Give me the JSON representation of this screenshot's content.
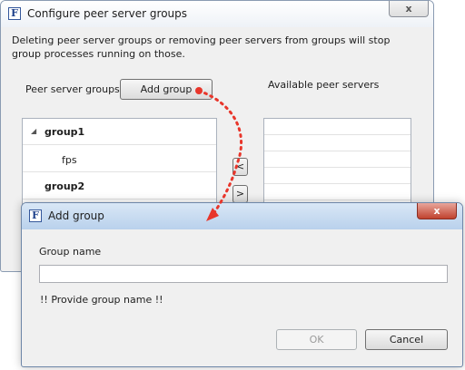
{
  "main_window": {
    "title": "Configure peer server groups",
    "icon_letter": "F",
    "close_label": "x",
    "info_text": "Deleting peer server groups or removing peer servers from groups will stop group processes running on those.",
    "peer_server_groups_label": "Peer server groups",
    "add_group_button": "Add group",
    "available_label": "Available peer servers",
    "groups": [
      {
        "name": "group1",
        "expander": "◢",
        "servers": [
          "fps"
        ]
      },
      {
        "name": "group2",
        "expander": "",
        "servers": []
      }
    ],
    "move_left_button": "<",
    "move_right_button": ">"
  },
  "dialog": {
    "title": "Add group",
    "icon_letter": "F",
    "close_label": "x",
    "group_name_label": "Group name",
    "group_name_value": "",
    "validation_message": "!! Provide group name !!",
    "ok_button": "OK",
    "cancel_button": "Cancel"
  },
  "colors": {
    "annotation_arrow": "#e8362b",
    "window_border": "#8a9bb2",
    "dialog_title_bar": "#b9d1ec"
  }
}
